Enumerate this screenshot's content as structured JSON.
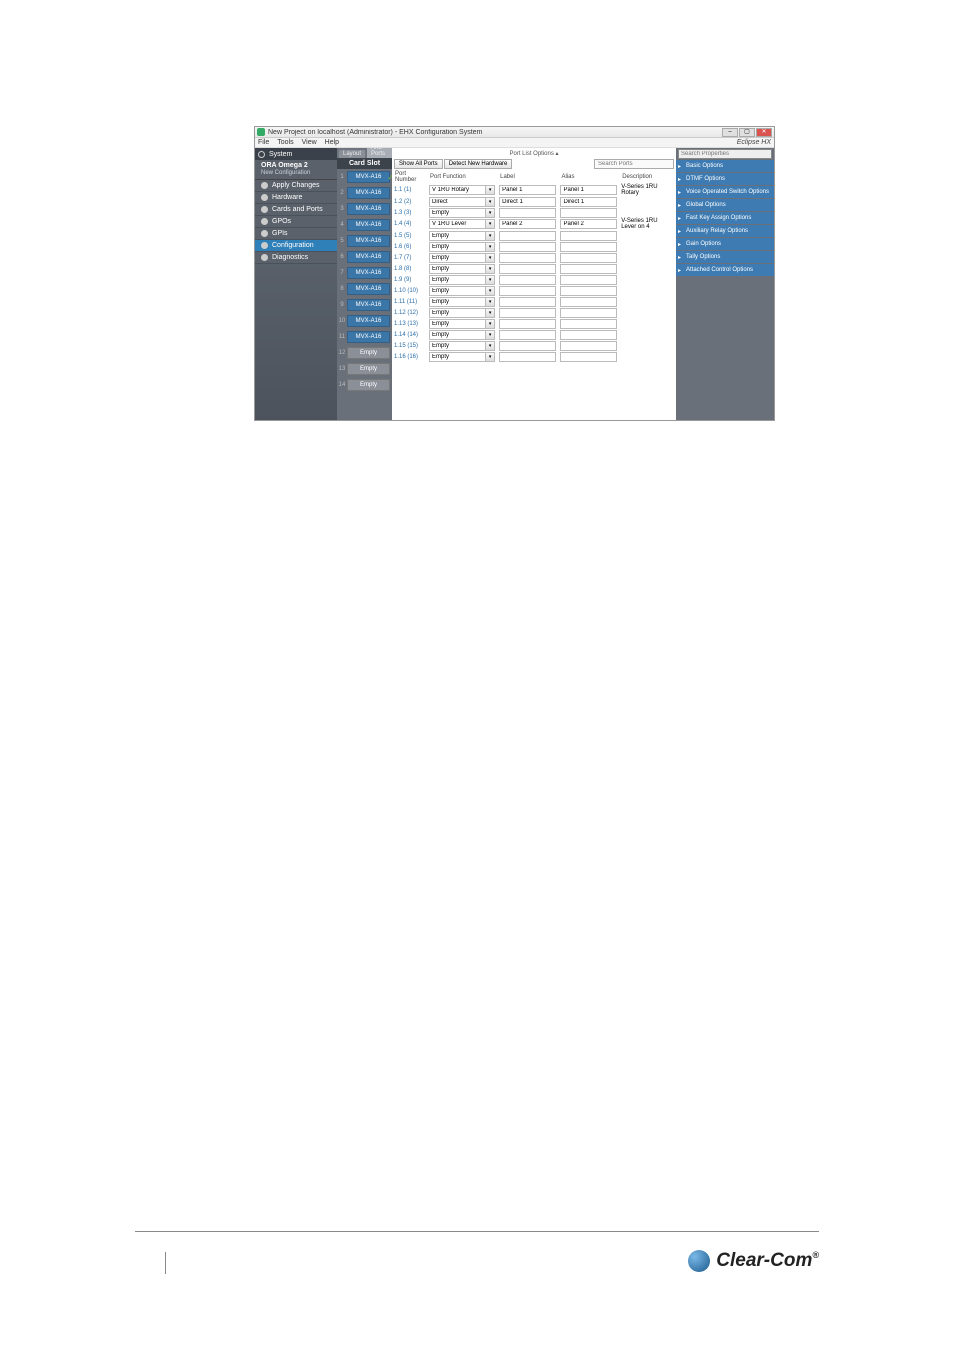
{
  "window": {
    "title": "New Project on localhost (Administrator) - EHX Configuration System",
    "brand": "Eclipse HX"
  },
  "menu": {
    "items": [
      "File",
      "Tools",
      "View",
      "Help"
    ]
  },
  "left_nav": {
    "system_label": "System",
    "device": "ORA Omega 2",
    "config": "New Configuration",
    "items": [
      {
        "label": "Apply Changes",
        "active": false
      },
      {
        "label": "Hardware",
        "active": false
      },
      {
        "label": "Cards and Ports",
        "active": false
      },
      {
        "label": "GPOs",
        "active": false
      },
      {
        "label": "GPIs",
        "active": false
      },
      {
        "label": "Configuration",
        "active": true
      },
      {
        "label": "Diagnostics",
        "active": false
      }
    ]
  },
  "tabs": {
    "layout": "Layout",
    "cards": "Cards And Ports",
    "active": "cards"
  },
  "slot_col": {
    "header": "Card Slot",
    "slots": [
      {
        "n": 1,
        "label": "MVX-A16",
        "selected": true
      },
      {
        "n": 2,
        "label": "MVX-A16"
      },
      {
        "n": 3,
        "label": "MVX-A16"
      },
      {
        "n": 4,
        "label": "MVX-A16"
      },
      {
        "n": 5,
        "label": "MVX-A16"
      },
      {
        "n": 6,
        "label": "MVX-A16"
      },
      {
        "n": 7,
        "label": "MVX-A16"
      },
      {
        "n": 8,
        "label": "MVX-A16"
      },
      {
        "n": 9,
        "label": "MVX-A16"
      },
      {
        "n": 10,
        "label": "MVX-A16"
      },
      {
        "n": 11,
        "label": "MVX-A16"
      },
      {
        "n": 12,
        "label": "Empty",
        "empty": true
      },
      {
        "n": 13,
        "label": "Empty",
        "empty": true
      },
      {
        "n": 14,
        "label": "Empty",
        "empty": true
      }
    ]
  },
  "main": {
    "port_list_options": "Port List Options ▴",
    "show_all": "Show All Ports",
    "detect": "Detect New Hardware",
    "search_placeholder": "Search Ports",
    "headers": {
      "port_number": "Port Number",
      "port_function": "Port Function",
      "label": "Label",
      "alias": "Alias",
      "description": "Description"
    },
    "rows": [
      {
        "pn": "1.1 (1)",
        "pf": "V 1RU Rotary",
        "label": "Panel 1",
        "alias": "Panel 1",
        "desc": "V-Series 1RU Rotary"
      },
      {
        "pn": "1.2 (2)",
        "pf": "Direct",
        "label": "Direct 1",
        "alias": "Direct 1",
        "desc": ""
      },
      {
        "pn": "1.3 (3)",
        "pf": "Empty",
        "label": "",
        "alias": "",
        "desc": ""
      },
      {
        "pn": "1.4 (4)",
        "pf": "V 1RU Lever",
        "label": "Panel 2",
        "alias": "Panel 2",
        "desc": "V-Series 1RU Lever on 4"
      },
      {
        "pn": "1.5 (5)",
        "pf": "Empty",
        "label": "",
        "alias": "",
        "desc": ""
      },
      {
        "pn": "1.6 (6)",
        "pf": "Empty",
        "label": "",
        "alias": "",
        "desc": ""
      },
      {
        "pn": "1.7 (7)",
        "pf": "Empty",
        "label": "",
        "alias": "",
        "desc": ""
      },
      {
        "pn": "1.8 (8)",
        "pf": "Empty",
        "label": "",
        "alias": "",
        "desc": ""
      },
      {
        "pn": "1.9 (9)",
        "pf": "Empty",
        "label": "",
        "alias": "",
        "desc": ""
      },
      {
        "pn": "1.10 (10)",
        "pf": "Empty",
        "label": "",
        "alias": "",
        "desc": ""
      },
      {
        "pn": "1.11 (11)",
        "pf": "Empty",
        "label": "",
        "alias": "",
        "desc": ""
      },
      {
        "pn": "1.12 (12)",
        "pf": "Empty",
        "label": "",
        "alias": "",
        "desc": ""
      },
      {
        "pn": "1.13 (13)",
        "pf": "Empty",
        "label": "",
        "alias": "",
        "desc": ""
      },
      {
        "pn": "1.14 (14)",
        "pf": "Empty",
        "label": "",
        "alias": "",
        "desc": ""
      },
      {
        "pn": "1.15 (15)",
        "pf": "Empty",
        "label": "",
        "alias": "",
        "desc": ""
      },
      {
        "pn": "1.16 (16)",
        "pf": "Empty",
        "label": "",
        "alias": "",
        "desc": ""
      }
    ]
  },
  "right": {
    "search_placeholder": "Search Properties",
    "sections": [
      "Basic Options",
      "DTMF Options",
      "Voice Operated Switch Options",
      "Global Options",
      "Fast Key Assign Options",
      "Auxiliary Relay Options",
      "Gain Options",
      "Tally Options",
      "Attached Control Options"
    ]
  },
  "footer": {
    "page": "",
    "brand": "Clear-Com",
    "reg": "®"
  }
}
